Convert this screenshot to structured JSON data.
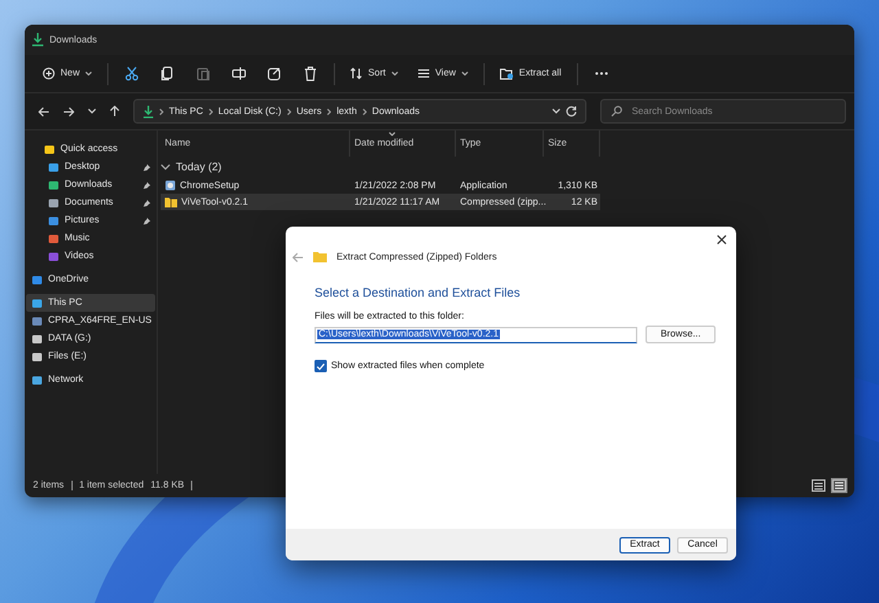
{
  "window": {
    "title": "Downloads"
  },
  "toolbar": [
    {
      "kind": "menu",
      "label": "New",
      "disabled": false
    },
    {
      "kind": "separator"
    },
    {
      "kind": "icon",
      "disabled": false
    },
    {
      "kind": "icon",
      "disabled": false
    },
    {
      "kind": "icon",
      "disabled": true
    },
    {
      "kind": "icon",
      "disabled": false
    },
    {
      "kind": "icon",
      "disabled": false
    },
    {
      "kind": "icon",
      "disabled": false
    },
    {
      "kind": "separator"
    },
    {
      "kind": "menu",
      "label": "Sort",
      "disabled": false
    },
    {
      "kind": "menu",
      "label": "View",
      "disabled": false
    },
    {
      "kind": "separator"
    },
    {
      "kind": "button",
      "label": "Extract all",
      "disabled": false
    },
    {
      "kind": "separator"
    },
    {
      "kind": "more",
      "disabled": false
    }
  ],
  "address": {
    "crumbs": [
      "This PC",
      "Local Disk (C:)",
      "Users",
      "lexth",
      "Downloads"
    ]
  },
  "search": {
    "placeholder": "Search Downloads"
  },
  "sidebar": {
    "sections": [
      {
        "items": [
          {
            "label": "Quick access",
            "pinned": false,
            "selected": false
          },
          {
            "label": "Desktop",
            "pinned": true,
            "selected": false
          },
          {
            "label": "Downloads",
            "pinned": true,
            "selected": false
          },
          {
            "label": "Documents",
            "pinned": true,
            "selected": false
          },
          {
            "label": "Pictures",
            "pinned": true,
            "selected": false
          },
          {
            "label": "Music",
            "pinned": false,
            "selected": false
          },
          {
            "label": "Videos",
            "pinned": false,
            "selected": false
          }
        ]
      },
      {
        "items": [
          {
            "label": "OneDrive",
            "pinned": false,
            "selected": false
          }
        ]
      },
      {
        "items": [
          {
            "label": "This PC",
            "pinned": false,
            "selected": true
          },
          {
            "label": "CPRA_X64FRE_EN-US",
            "pinned": false,
            "selected": false
          },
          {
            "label": "DATA (G:)",
            "pinned": false,
            "selected": false
          },
          {
            "label": "Files (E:)",
            "pinned": false,
            "selected": false
          }
        ]
      },
      {
        "items": [
          {
            "label": "Network",
            "pinned": false,
            "selected": false
          }
        ]
      }
    ]
  },
  "table": {
    "columns": [
      {
        "label": "Name",
        "sorted": false
      },
      {
        "label": "Date modified",
        "sorted": true
      },
      {
        "label": "Type",
        "sorted": false
      },
      {
        "label": "Size",
        "sorted": false
      }
    ],
    "group": {
      "label": "Today (2)",
      "expanded": true
    },
    "rows": [
      {
        "name": "ChromeSetup",
        "date": "1/21/2022 2:08 PM",
        "type": "Application",
        "size": "1,310 KB",
        "selected": false
      },
      {
        "name": "ViVeTool-v0.2.1",
        "date": "1/21/2022 11:17 AM",
        "type": "Compressed (zipp...",
        "size": "12 KB",
        "selected": true
      }
    ]
  },
  "status_bar": {
    "texts": [
      "2 items",
      "1 item selected",
      "11.8 KB"
    ],
    "view_buttons": [
      {
        "selected": false
      },
      {
        "selected": true
      }
    ]
  },
  "dialog": {
    "title": "Extract Compressed (Zipped) Folders",
    "heading": "Select a Destination and Extract Files",
    "field_label": "Files will be extracted to this folder:",
    "path": {
      "value": "C:\\Users\\lexth\\Downloads\\ViVeTool-v0.2.1",
      "selected": true
    },
    "browse": "Browse...",
    "checkbox": {
      "label": "Show extracted files when complete",
      "checked": true
    },
    "buttons": [
      {
        "label": "Extract",
        "primary": true
      },
      {
        "label": "Cancel",
        "primary": false
      }
    ]
  }
}
